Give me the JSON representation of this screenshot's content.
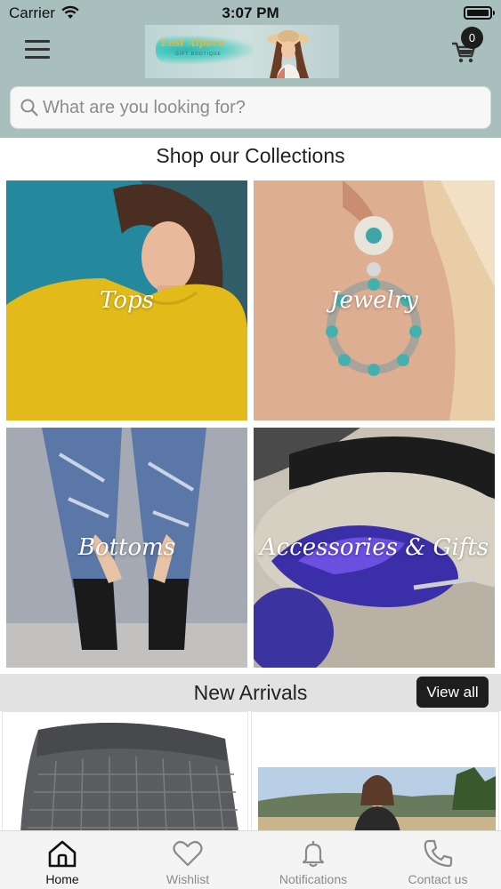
{
  "status_bar": {
    "carrier": "Carrier",
    "time": "3:07 PM"
  },
  "header": {
    "logo_text": "Lost Alpaca",
    "logo_subtext": "GIFT BOUTIQUE",
    "cart_count": "0"
  },
  "search": {
    "placeholder": "What are you looking for?"
  },
  "collections": {
    "title": "Shop our Collections",
    "items": [
      {
        "label": "Tops"
      },
      {
        "label": "Jewelry"
      },
      {
        "label": "Bottoms"
      },
      {
        "label": "Accessories & Gifts"
      }
    ]
  },
  "new_arrivals": {
    "title": "New Arrivals",
    "view_all_label": "View all"
  },
  "tab_bar": {
    "items": [
      {
        "label": "Home",
        "icon": "home-icon",
        "active": true
      },
      {
        "label": "Wishlist",
        "icon": "heart-icon",
        "active": false
      },
      {
        "label": "Notifications",
        "icon": "bell-icon",
        "active": false
      },
      {
        "label": "Contact us",
        "icon": "phone-icon",
        "active": false
      }
    ]
  },
  "colors": {
    "header_bg": "#a9bfbd",
    "accent_dark": "#1e1e1e",
    "section_bar_bg": "#e2e2e2",
    "tab_active": "#111111",
    "tab_inactive": "#8a8a8a"
  }
}
